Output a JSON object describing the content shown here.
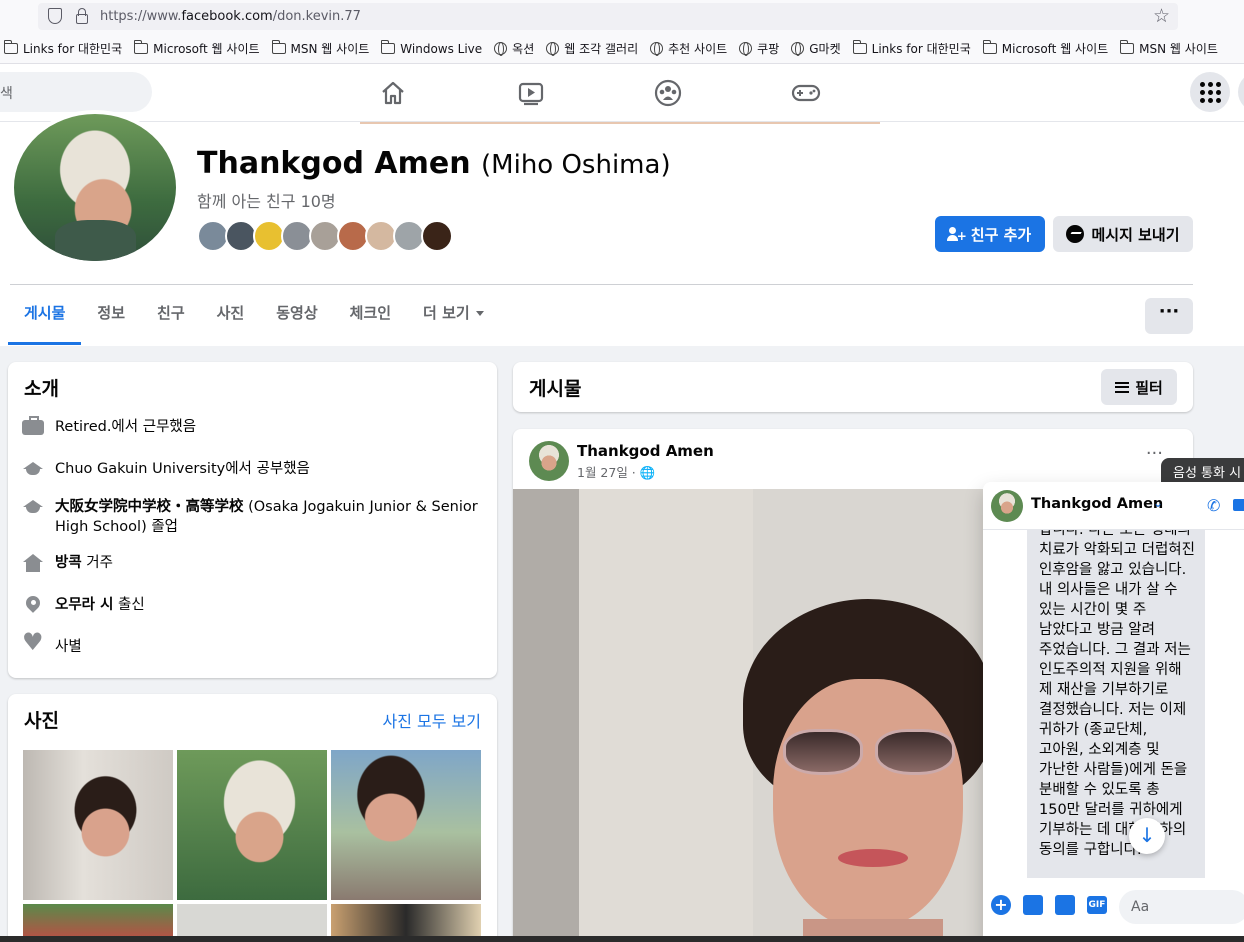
{
  "browser": {
    "url_prefix": "https://www.",
    "url_domain": "facebook.com",
    "url_path": "/don.kevin.77"
  },
  "bookmarks": [
    {
      "icon": "folder-icon",
      "label": "Links for 대한민국"
    },
    {
      "icon": "folder-icon",
      "label": "Microsoft 웹 사이트"
    },
    {
      "icon": "folder-icon",
      "label": "MSN 웹 사이트"
    },
    {
      "icon": "folder-icon",
      "label": "Windows Live"
    },
    {
      "icon": "globe-icon",
      "label": "옥션"
    },
    {
      "icon": "globe-icon",
      "label": "웹 조각 갤러리"
    },
    {
      "icon": "globe-icon",
      "label": "추천 사이트"
    },
    {
      "icon": "globe-icon",
      "label": "쿠팡"
    },
    {
      "icon": "globe-icon",
      "label": "G마켓"
    },
    {
      "icon": "folder-icon",
      "label": "Links for 대한민국"
    },
    {
      "icon": "folder-icon",
      "label": "Microsoft 웹 사이트"
    },
    {
      "icon": "folder-icon",
      "label": "MSN 웹 사이트"
    }
  ],
  "fbnav": {
    "search_placeholder": "색",
    "icons": [
      "home-icon",
      "watch-icon",
      "groups-icon",
      "gaming-icon"
    ]
  },
  "profile": {
    "name": "Thankgod Amen",
    "alt_name": "(Miho Oshima)",
    "mutual_friends": "함께 아는 친구 10명",
    "add_friend_label": "친구 추가",
    "message_label": "메시지 보내기",
    "friend_avatar_colors": [
      "#7a8a9a",
      "#4a5560",
      "#e8c030",
      "#8a8f96",
      "#a8a098",
      "#b86a4a",
      "#d4b8a0",
      "#9ea4a8",
      "#3a2418"
    ]
  },
  "tabs": [
    {
      "label": "게시물",
      "active": true
    },
    {
      "label": "정보",
      "active": false
    },
    {
      "label": "친구",
      "active": false
    },
    {
      "label": "사진",
      "active": false
    },
    {
      "label": "동영상",
      "active": false
    },
    {
      "label": "체크인",
      "active": false
    },
    {
      "label": "더 보기",
      "active": false
    }
  ],
  "more_label": "···",
  "intro": {
    "title": "소개",
    "items": [
      {
        "icon": "briefcase-icon",
        "bold": "",
        "text": "Retired.에서 근무했음"
      },
      {
        "icon": "graduation-cap-icon",
        "bold": "",
        "text": "Chuo Gakuin University에서 공부했음"
      },
      {
        "icon": "graduation-cap-icon",
        "bold": "大阪女学院中学校・高等学校",
        "text": " (Osaka Jogakuin Junior & Senior High School) 졸업"
      },
      {
        "icon": "home-icon",
        "bold": "방콕",
        "text": " 거주"
      },
      {
        "icon": "location-pin-icon",
        "bold": "오무라 시",
        "text": " 출신"
      },
      {
        "icon": "heart-icon",
        "bold": "",
        "text": "사별"
      }
    ]
  },
  "photos": {
    "title": "사진",
    "see_all": "사진 모두 보기"
  },
  "posts": {
    "title": "게시물",
    "filter_label": "필터"
  },
  "post": {
    "author": "Thankgod Amen",
    "date": "1월 27일 ·",
    "dots": "···"
  },
  "tooltip": {
    "text": "음성 통화 시"
  },
  "chat": {
    "name": "Thankgod Amen",
    "message": "합니다. 다른 모든 형태의 치료가 악화되고 더럽혀진 인후암을 앓고 있습니다. 내 의사들은 내가 살 수 있는 시간이 몇 주 남았다고 방금 알려 주었습니다. 그 결과 저는 인도주의적 지원을 위해 제 재산을 기부하기로 결정했습니다. 저는 이제 귀하가 (종교단체, 고아원, 소외계층 및 가난한 사람들)에게 돈을 분배할 수 있도록 총 150만 달러를 귀하에게 기부하는 데 대한 귀하의 동의를 구합니다.",
    "input_placeholder": "Aa"
  },
  "colors": {
    "fb_blue": "#1b74e4",
    "secondary_text": "#65676b",
    "background": "#f0f2f5"
  }
}
